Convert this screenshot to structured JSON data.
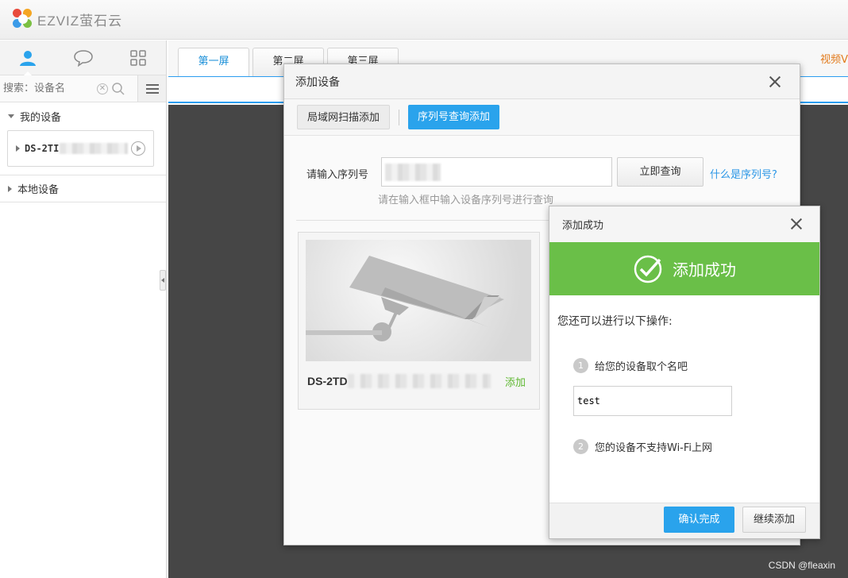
{
  "app": {
    "brand": "EZVIZ萤石云"
  },
  "sidebar": {
    "tabs": [
      {
        "icon": "user-icon"
      },
      {
        "icon": "chat-icon"
      },
      {
        "icon": "grid-icon"
      }
    ],
    "search": {
      "placeholder": "搜索：设备名"
    },
    "groups": {
      "my_devices": "我的设备",
      "local_devices": "本地设备"
    },
    "device_item": {
      "name_prefix": "DS-2TI"
    }
  },
  "main": {
    "tabs": [
      "第一屏",
      "第二屏",
      "第三屏"
    ],
    "video_link": "视频V",
    "watermark": "CSDN @fleaxin"
  },
  "add_dialog": {
    "title": "添加设备",
    "modes": {
      "lan_scan": "局域网扫描添加",
      "serial_query": "序列号查询添加"
    },
    "serial_label": "请输入序列号",
    "query_button": "立即查询",
    "what_is_serial": "什么是序列号?",
    "hint": "请在输入框中输入设备序列号进行查询",
    "card": {
      "name_prefix": "DS-2TD",
      "add_label": "添加"
    }
  },
  "success_dialog": {
    "title": "添加成功",
    "banner": "添加成功",
    "prompt": "您还可以进行以下操作:",
    "steps": [
      {
        "num": "1",
        "text": "给您的设备取个名吧"
      },
      {
        "num": "2",
        "text": "您的设备不支持Wi-Fi上网"
      }
    ],
    "name_value": "test",
    "confirm_button": "确认完成",
    "continue_button": "继续添加"
  },
  "colors": {
    "accent_blue": "#2aa3ec",
    "success_green": "#6abf48",
    "link_orange": "#e27a1b"
  }
}
